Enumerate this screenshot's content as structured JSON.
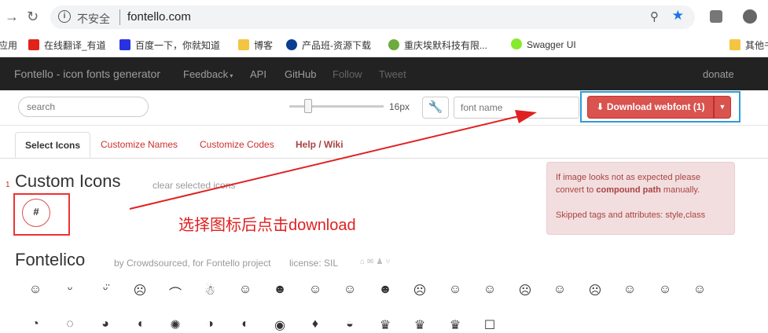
{
  "browser": {
    "insecure_label": "不安全",
    "host": "fontello.com",
    "bookmarks": [
      {
        "label": "应用",
        "color": "#ffffff"
      },
      {
        "label": "在线翻译_有道",
        "color": "#e2231a"
      },
      {
        "label": "百度一下，你就知道",
        "color": "#2932e1"
      },
      {
        "label": "博客",
        "color": "#f4c542"
      },
      {
        "label": "产品班-资源下载",
        "color": "#0b3d91"
      },
      {
        "label": "重庆埃默科技有限...",
        "color": "#6cab3c"
      },
      {
        "label": "Swagger UI",
        "color": "#85ea2d"
      },
      {
        "label": "其他书",
        "color": "#f4c542"
      }
    ]
  },
  "nav": {
    "brand": "Fontello - icon fonts generator",
    "feedback": "Feedback",
    "api": "API",
    "github": "GitHub",
    "follow": "Follow",
    "tweet": "Tweet",
    "donate": "donate"
  },
  "toolbar": {
    "search_placeholder": "search",
    "font_size": "16px",
    "font_name_placeholder": "font name",
    "download_label": "Download webfont (1)",
    "slider_fraction": 0.2
  },
  "tabs": [
    "Select Icons",
    "Customize Names",
    "Customize Codes",
    "Help / Wiki"
  ],
  "custom": {
    "number": "1",
    "title": "Custom Icons",
    "clear": "clear selected icons",
    "annotation": "选择图标后点击download",
    "alert_line1_a": "If image looks not as expected please convert to ",
    "alert_line1_b": "compound path",
    "alert_line1_c": " manually.",
    "alert_line2": "Skipped tags and attributes: style,class"
  },
  "fontelico": {
    "title": "Fontelico",
    "by": "by Crowdsourced, for Fontello project",
    "license": "license: SIL",
    "row1": [
      "☺",
      "ᵕ",
      "ᵕ̈",
      "☹",
      "⌒",
      "☃",
      "☺",
      "☻",
      "☺",
      "☺",
      "☻",
      "☹",
      "☺",
      "☺",
      "☹",
      "☺",
      "☹",
      "☺",
      "☺",
      "☺"
    ],
    "row2": [
      "◔",
      "◌",
      "◕",
      "◖",
      "✺",
      "◑",
      "◐",
      "◉",
      "♦",
      "◒",
      "♛",
      "♛",
      "♛",
      "☐"
    ]
  },
  "colors": {
    "accent_red": "#d9534f",
    "highlight_blue": "#2d9bd9",
    "annotation_red": "#e02020"
  }
}
